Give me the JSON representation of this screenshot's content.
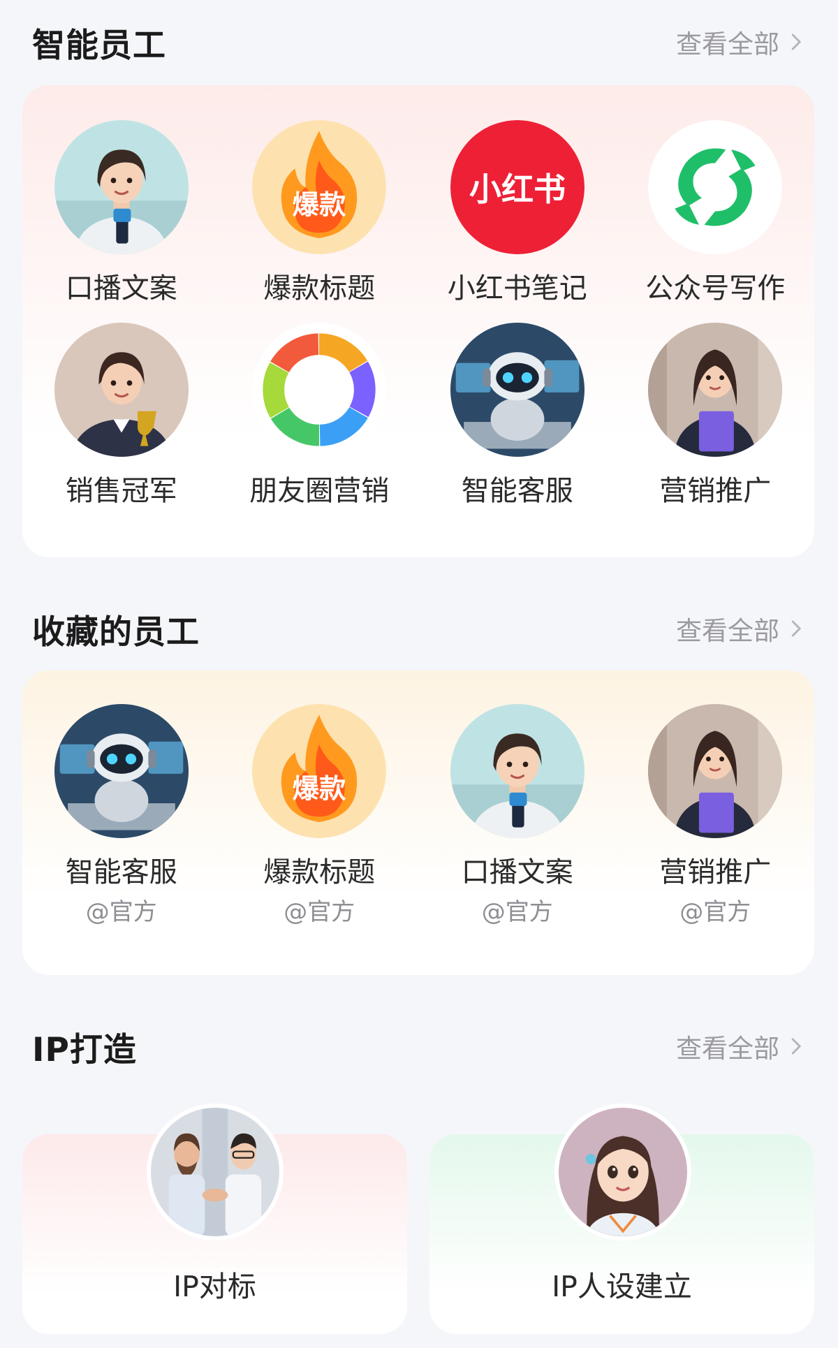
{
  "sections": {
    "employees": {
      "title": "智能员工",
      "view_all": "查看全部"
    },
    "favorites": {
      "title": "收藏的员工",
      "view_all": "查看全部"
    },
    "ip": {
      "title": "IP打造",
      "view_all": "查看全部"
    }
  },
  "employees": [
    {
      "label": "口播文案",
      "icon": "broadcaster-avatar"
    },
    {
      "label": "爆款标题",
      "icon": "fire-badge-icon",
      "badge_text": "爆款"
    },
    {
      "label": "小红书笔记",
      "icon": "xiaohongshu-logo",
      "badge_text": "小红书"
    },
    {
      "label": "公众号写作",
      "icon": "wechat-official-account-logo"
    },
    {
      "label": "销售冠军",
      "icon": "sales-champion-avatar"
    },
    {
      "label": "朋友圈营销",
      "icon": "moments-ring-icon"
    },
    {
      "label": "智能客服",
      "icon": "robot-avatar"
    },
    {
      "label": "营销推广",
      "icon": "marketer-avatar"
    }
  ],
  "favorites": [
    {
      "label": "智能客服",
      "sub": "@官方",
      "icon": "robot-avatar"
    },
    {
      "label": "爆款标题",
      "sub": "@官方",
      "icon": "fire-badge-icon",
      "badge_text": "爆款"
    },
    {
      "label": "口播文案",
      "sub": "@官方",
      "icon": "broadcaster-avatar"
    },
    {
      "label": "营销推广",
      "sub": "@官方",
      "icon": "marketer-avatar"
    }
  ],
  "ip_items": [
    {
      "label": "IP对标",
      "icon": "handshake-avatar"
    },
    {
      "label": "IP人设建立",
      "icon": "girl-persona-avatar"
    }
  ],
  "colors": {
    "background": "#f5f6fa",
    "xiaohongshu_red": "#ee2036",
    "wechat_green": "#1fbf6a",
    "muted_text": "#9a9aa0"
  }
}
